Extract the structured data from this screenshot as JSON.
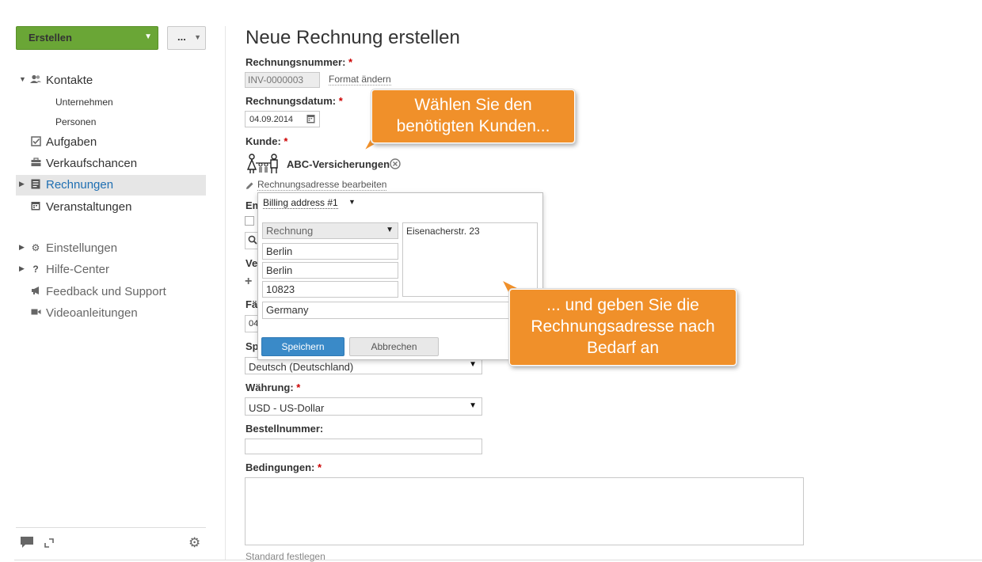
{
  "sidebar": {
    "create_label": "Erstellen",
    "more_label": "...",
    "nav": [
      {
        "label": "Kontakte"
      },
      {
        "label": "Unternehmen"
      },
      {
        "label": "Personen"
      },
      {
        "label": "Aufgaben"
      },
      {
        "label": "Verkaufschancen"
      },
      {
        "label": "Rechnungen"
      },
      {
        "label": "Veranstaltungen"
      },
      {
        "label": "Einstellungen"
      },
      {
        "label": "Hilfe-Center"
      },
      {
        "label": "Feedback und Support"
      },
      {
        "label": "Videoanleitungen"
      }
    ]
  },
  "form": {
    "title": "Neue Rechnung erstellen",
    "required_mark": "*",
    "invoice_number_label": "Rechnungsnummer:",
    "invoice_number_value": "INV-0000003",
    "change_format_link": "Format ändern",
    "invoice_date_label": "Rechnungsdatum:",
    "invoice_date_value": "04.09.2014",
    "customer_label": "Kunde:",
    "customer_name": "ABC-Versicherungen",
    "edit_billing_link": "Rechnungsadresse bearbeiten",
    "partial_labels": {
      "em": "Em",
      "ve": "Ve",
      "fae": "Fäl",
      "sp": "Sp"
    },
    "due_date_partial": "04",
    "language_value": "Deutsch (Deutschland)",
    "currency_label": "Währung:",
    "currency_value": "USD - US-Dollar",
    "order_number_label": "Bestellnummer:",
    "order_number_value": "",
    "terms_label": "Bedingungen:",
    "set_default_link": "Standard festlegen"
  },
  "billing_popup": {
    "address_selector": "Billing address #1",
    "type_select": "Rechnung",
    "street": "Eisenacherstr. 23",
    "city": "Berlin",
    "state": "Berlin",
    "zip": "10823",
    "country": "Germany",
    "save_label": "Speichern",
    "cancel_label": "Abbrechen"
  },
  "callouts": {
    "first": [
      "Wählen Sie den",
      "benötigten Kunden..."
    ],
    "second": [
      "... und geben Sie die",
      "Rechnungsadresse nach",
      "Bedarf an"
    ]
  },
  "colors": {
    "create_button": "#6aa636",
    "active_nav_text": "#1f6fb2",
    "save_button": "#3a8ac8",
    "callout": "#f0902a",
    "required": "#cc0000"
  }
}
